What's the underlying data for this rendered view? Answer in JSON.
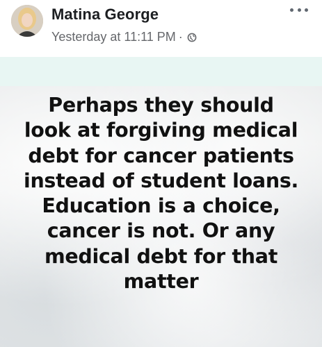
{
  "post": {
    "author": "Matina George",
    "timestamp": "Yesterday at 11:11 PM",
    "separator": "·",
    "audience_icon": "globe-icon",
    "menu_icon": "more-options-icon"
  },
  "image_text": {
    "lines": [
      "Perhaps they should",
      "look at forgiving medical",
      "debt for cancer patients",
      "instead of student loans.",
      "Education is a choice,",
      "cancer is not. Or any",
      "medical debt for that",
      "matter"
    ]
  },
  "colors": {
    "author": "#1c1e21",
    "meta": "#65676b",
    "image_band": "#e8f6f3",
    "quote_text": "#111111"
  }
}
